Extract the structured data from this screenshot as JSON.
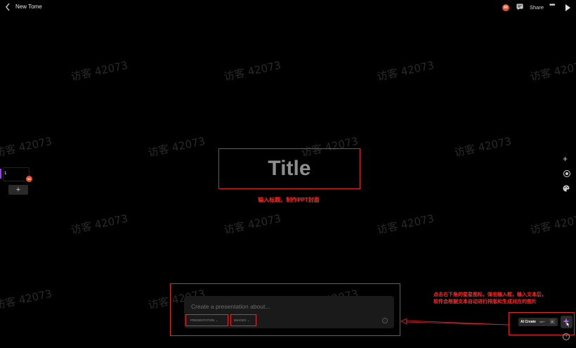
{
  "header": {
    "back_icon": "chevron-left-icon",
    "doc_title": "New Tome",
    "avatar_badge": "60",
    "comment_icon": "comment-icon",
    "share_label": "Share",
    "more_label": "•••",
    "play_icon": "play-icon"
  },
  "watermark": "访客 42073",
  "slides": {
    "items": [
      {
        "number": "1",
        "badge": "60"
      }
    ],
    "add_label": "+"
  },
  "canvas": {
    "title_placeholder": "Title",
    "annotation_title": "输入标题，制作PPT封面"
  },
  "right_tools": {
    "add_icon": "plus-icon",
    "record_icon": "record-icon",
    "theme_icon": "palette-icon"
  },
  "prompt": {
    "placeholder": "Create a presentation about...",
    "type_select": "PRESENTATION ⌄",
    "images_select": "IMAGES ⌄",
    "info_icon": "i"
  },
  "ai_create": {
    "label": "AI Create",
    "shortcut": "ctrl+",
    "shortcut_key": "K",
    "help_label": "?",
    "annotation_line1": "点击右下角的星星图标，弹出输入框，输入文本后，",
    "annotation_line2": "软件会根据文本自动进行排版和生成对应的图片"
  },
  "colors": {
    "background": "#000000",
    "annotation_red": "#ff2a2a",
    "accent_purple": "#9b3ff0",
    "badge_orange": "#e0522b"
  }
}
